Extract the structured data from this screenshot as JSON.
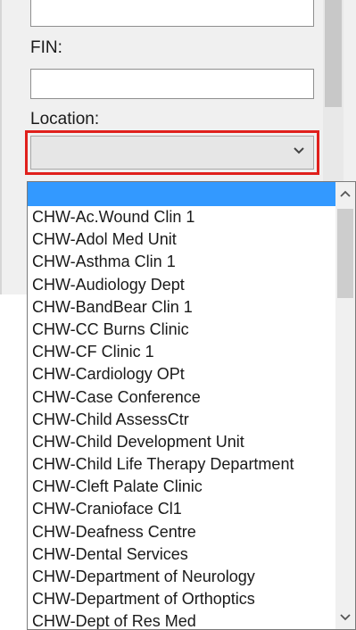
{
  "form": {
    "fin_label": "FIN:",
    "fin_value": "",
    "location_label": "Location:",
    "location_value": ""
  },
  "dropdown": {
    "selected_item": "",
    "options": [
      "CHW-Ac.Wound Clin 1",
      "CHW-Adol Med Unit",
      "CHW-Asthma Clin 1",
      "CHW-Audiology Dept",
      "CHW-BandBear Clin 1",
      "CHW-CC Burns Clinic",
      "CHW-CF Clinic 1",
      "CHW-Cardiology OPt",
      "CHW-Case Conference",
      "CHW-Child AssessCtr",
      "CHW-Child Development Unit",
      "CHW-Child Life Therapy Department",
      "CHW-Cleft Palate Clinic",
      "CHW-Craniofacе Cl1",
      "CHW-Deafness Centre",
      "CHW-Dental Services",
      "CHW-Department of Neurology",
      "CHW-Department of Orthoptics",
      "CHW-Dept of Res Med"
    ]
  },
  "colors": {
    "highlight_border": "#e0201c",
    "selection": "#3399ff"
  },
  "icons": {
    "select_chevron": "chevron-down-icon",
    "scroll_up": "scroll-up-arrow-icon",
    "scroll_down": "scroll-down-arrow-icon"
  }
}
